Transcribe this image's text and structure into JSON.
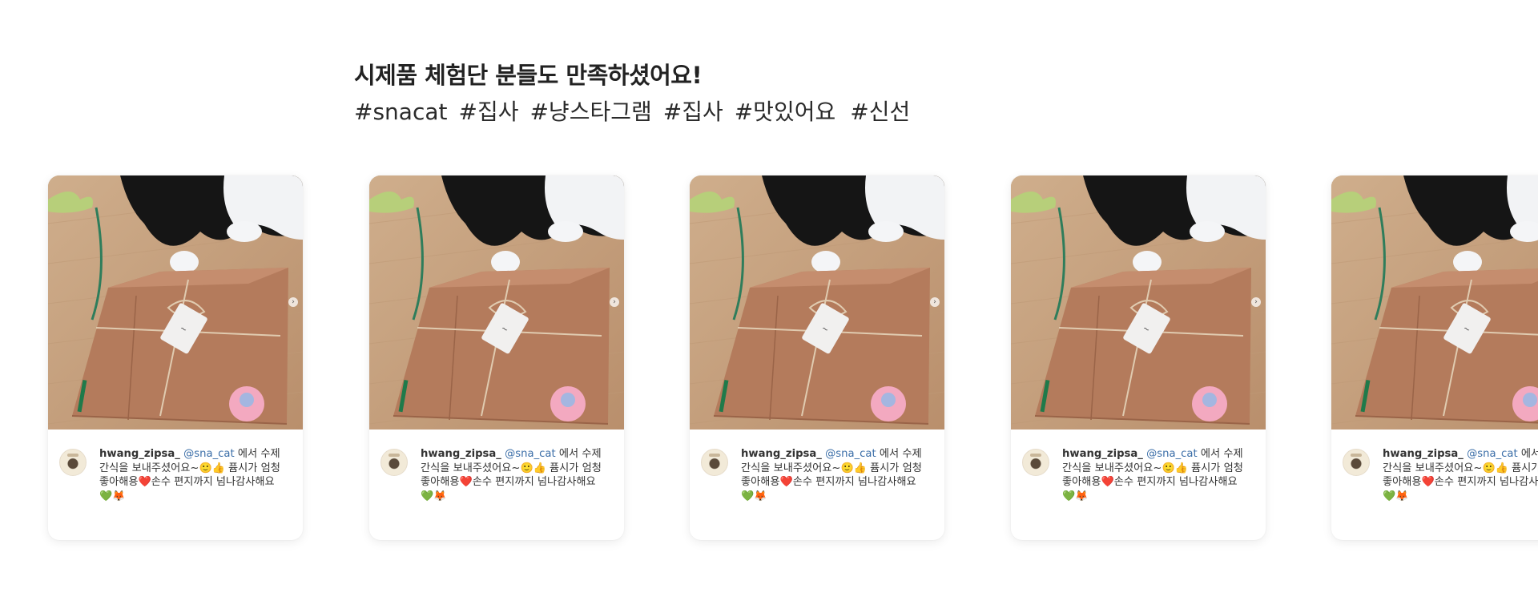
{
  "section": {
    "title": "시제품 체험단 분들도 만족하셨어요!",
    "tags": [
      "#snacat",
      "#집사",
      "#냥스타그램",
      "#집사",
      "#맛있어요",
      "#신선"
    ]
  },
  "cards": [
    {
      "username": "hwang_zipsa_",
      "mention": "@sna_cat",
      "text1": "에서 수제 간식을 보내주셨어요~",
      "emoji1": "🙂👍",
      "text2": "퓸시가 엄청 좋아해용",
      "emoji2": "❤️",
      "text3": "손수 편지까지 넘나감사해요",
      "emoji3": "💚🦊",
      "arrow": "›"
    },
    {
      "username": "hwang_zipsa_",
      "mention": "@sna_cat",
      "text1": "에서 수제 간식을 보내주셨어요~",
      "emoji1": "🙂👍",
      "text2": "퓸시가 엄청 좋아해용",
      "emoji2": "❤️",
      "text3": "손수 편지까지 넘나감사해요",
      "emoji3": "💚🦊",
      "arrow": "›"
    },
    {
      "username": "hwang_zipsa_",
      "mention": "@sna_cat",
      "text1": "에서 수제 간식을 보내주셨어요~",
      "emoji1": "🙂👍",
      "text2": "퓸시가 엄청 좋아해용",
      "emoji2": "❤️",
      "text3": "손수 편지까지 넘나감사해요",
      "emoji3": "💚🦊",
      "arrow": "›"
    },
    {
      "username": "hwang_zipsa_",
      "mention": "@sna_cat",
      "text1": "에서 수제 간식을 보내주셨어요~",
      "emoji1": "🙂👍",
      "text2": "퓸시가 엄청 좋아해용",
      "emoji2": "❤️",
      "text3": "손수 편지까지 넘나감사해요",
      "emoji3": "💚🦊",
      "arrow": "›"
    },
    {
      "username": "hwang_zipsa_",
      "mention": "@sna_cat",
      "text1": "에서 수제 간식을 보내주셨어요~",
      "emoji1": "🙂👍",
      "text2": "퓸시가 엄청 좋아해용",
      "emoji2": "❤️",
      "text3": "손수 편지까지 넘나감사해요",
      "emoji3": "💚🦊",
      "arrow": "›"
    }
  ]
}
